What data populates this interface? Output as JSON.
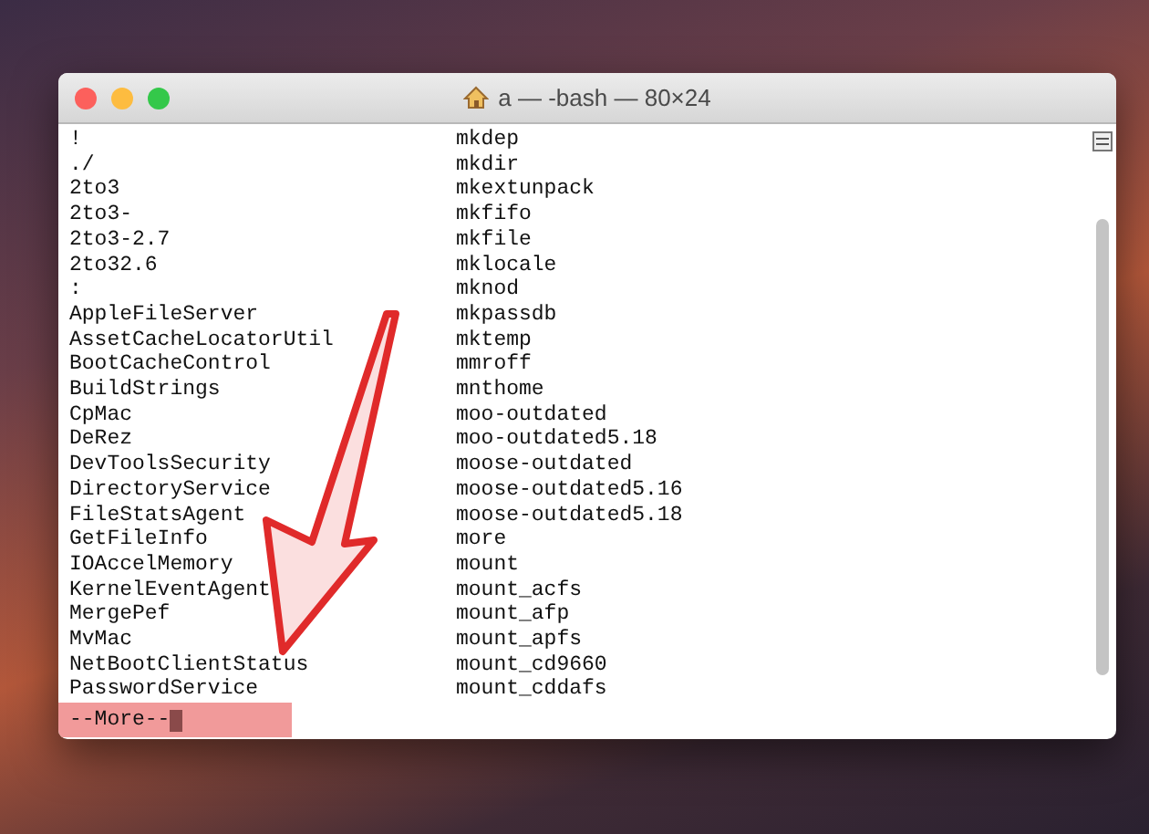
{
  "window": {
    "title": "a — -bash — 80×24"
  },
  "listing": [
    {
      "left": "!",
      "right": "mkdep"
    },
    {
      "left": "./",
      "right": "mkdir"
    },
    {
      "left": "2to3",
      "right": "mkextunpack"
    },
    {
      "left": "2to3-",
      "right": "mkfifo"
    },
    {
      "left": "2to3-2.7",
      "right": "mkfile"
    },
    {
      "left": "2to32.6",
      "right": "mklocale"
    },
    {
      "left": ":",
      "right": "mknod"
    },
    {
      "left": "AppleFileServer",
      "right": "mkpassdb"
    },
    {
      "left": "AssetCacheLocatorUtil",
      "right": "mktemp"
    },
    {
      "left": "BootCacheControl",
      "right": "mmroff"
    },
    {
      "left": "BuildStrings",
      "right": "mnthome"
    },
    {
      "left": "CpMac",
      "right": "moo-outdated"
    },
    {
      "left": "DeRez",
      "right": "moo-outdated5.18"
    },
    {
      "left": "DevToolsSecurity",
      "right": "moose-outdated"
    },
    {
      "left": "DirectoryService",
      "right": "moose-outdated5.16"
    },
    {
      "left": "FileStatsAgent",
      "right": "moose-outdated5.18"
    },
    {
      "left": "GetFileInfo",
      "right": "more"
    },
    {
      "left": "IOAccelMemory",
      "right": "mount"
    },
    {
      "left": "KernelEventAgent",
      "right": "mount_acfs"
    },
    {
      "left": "MergePef",
      "right": "mount_afp"
    },
    {
      "left": "MvMac",
      "right": "mount_apfs"
    },
    {
      "left": "NetBootClientStatus",
      "right": "mount_cd9660"
    },
    {
      "left": "PasswordService",
      "right": "mount_cddafs"
    }
  ],
  "prompt": {
    "text": "--More--"
  }
}
